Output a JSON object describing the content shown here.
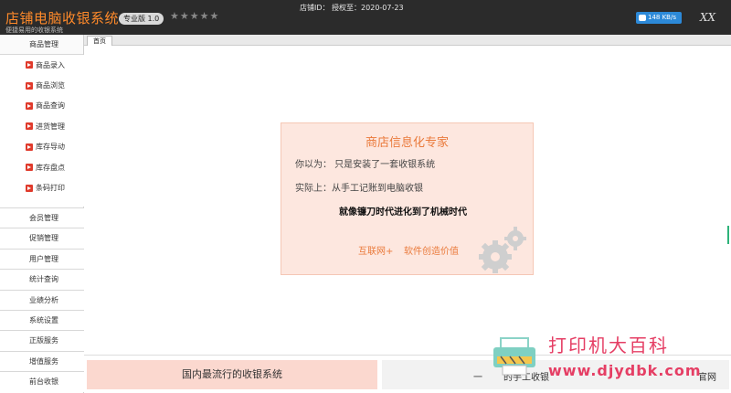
{
  "window": {
    "app_title": "店铺电脑收银系统",
    "app_subtitle": "便捷易用的收银系统",
    "version_badge": "专业版 1.0",
    "rating": "★★★★★",
    "store_line": "店铺ID：   授权至：2020-07-23",
    "speed": "148 KB/s",
    "close_label": "XX"
  },
  "sidebar": {
    "section_title": "商品管理",
    "sub_items": [
      "商品录入",
      "商品浏览",
      "商品查询",
      "进货管理",
      "库存导动",
      "库存盘点",
      "条码打印"
    ],
    "menu_items": [
      "会员管理",
      "促销管理",
      "用户管理",
      "统计查询",
      "业绩分析",
      "系统设置",
      "正版服务",
      "增值服务",
      "前台收银"
    ]
  },
  "tabs": [
    {
      "label": "首页"
    }
  ],
  "card": {
    "title": "商店信息化专家",
    "line1": "你以为：  只是安装了一套收银系统",
    "line2": "实际上：从手工记账到电脑收银",
    "line3": "就像镰刀时代进化到了机械时代",
    "footer_a": "互联网+",
    "footer_b": "软件创造价值"
  },
  "bottom": {
    "left_text": "国内最流行的收银系统",
    "right_dash": "一",
    "right_text": "的手工收银",
    "right_site": "官网"
  },
  "watermark": {
    "line1": "打印机大百科",
    "line2": "www.djydbk.com"
  },
  "colors": {
    "accent": "#ea7a3b",
    "titlebar": "#2b2b2b",
    "card_bg": "#fde7df",
    "watermark": "#e53e64"
  }
}
